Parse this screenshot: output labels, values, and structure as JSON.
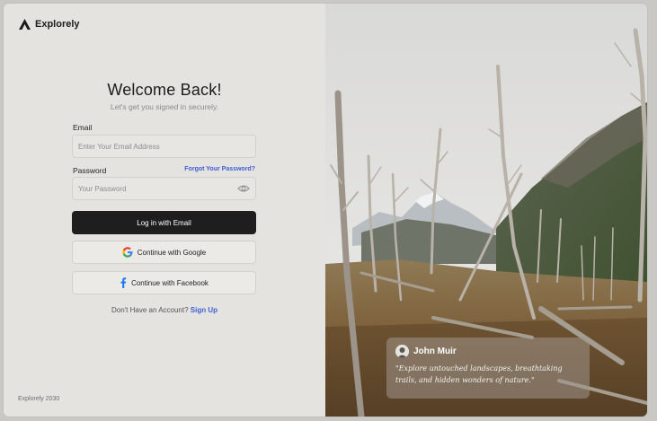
{
  "brand": {
    "name": "Explorely"
  },
  "login": {
    "title": "Welcome Back!",
    "subtitle": "Let's get you signed in securely.",
    "email_label": "Email",
    "email_placeholder": "Enter Your Email Address",
    "password_label": "Password",
    "forgot_label": "Forgot Your Password?",
    "password_placeholder": "Your Password",
    "login_button": "Log in with Email",
    "google_button": "Continue with Google",
    "facebook_button": "Continue with Facebook",
    "no_account_text": "Don't Have an Account?",
    "signup_link": "Sign Up"
  },
  "footer": {
    "text": "Explorely 2030"
  },
  "quote": {
    "author": "John Muir",
    "text": "\"Explore untouched landscapes, breathtaking trails, and hidden wonders of nature.\""
  },
  "icons": {
    "logo": "mountain-a-logo",
    "eye": "eye-icon",
    "google": "google-icon",
    "facebook": "facebook-icon",
    "avatar": "person-avatar"
  },
  "colors": {
    "primary_button": "#1e1e1e",
    "link": "#3f5fd6",
    "panel_bg": "#e4e3e0"
  }
}
